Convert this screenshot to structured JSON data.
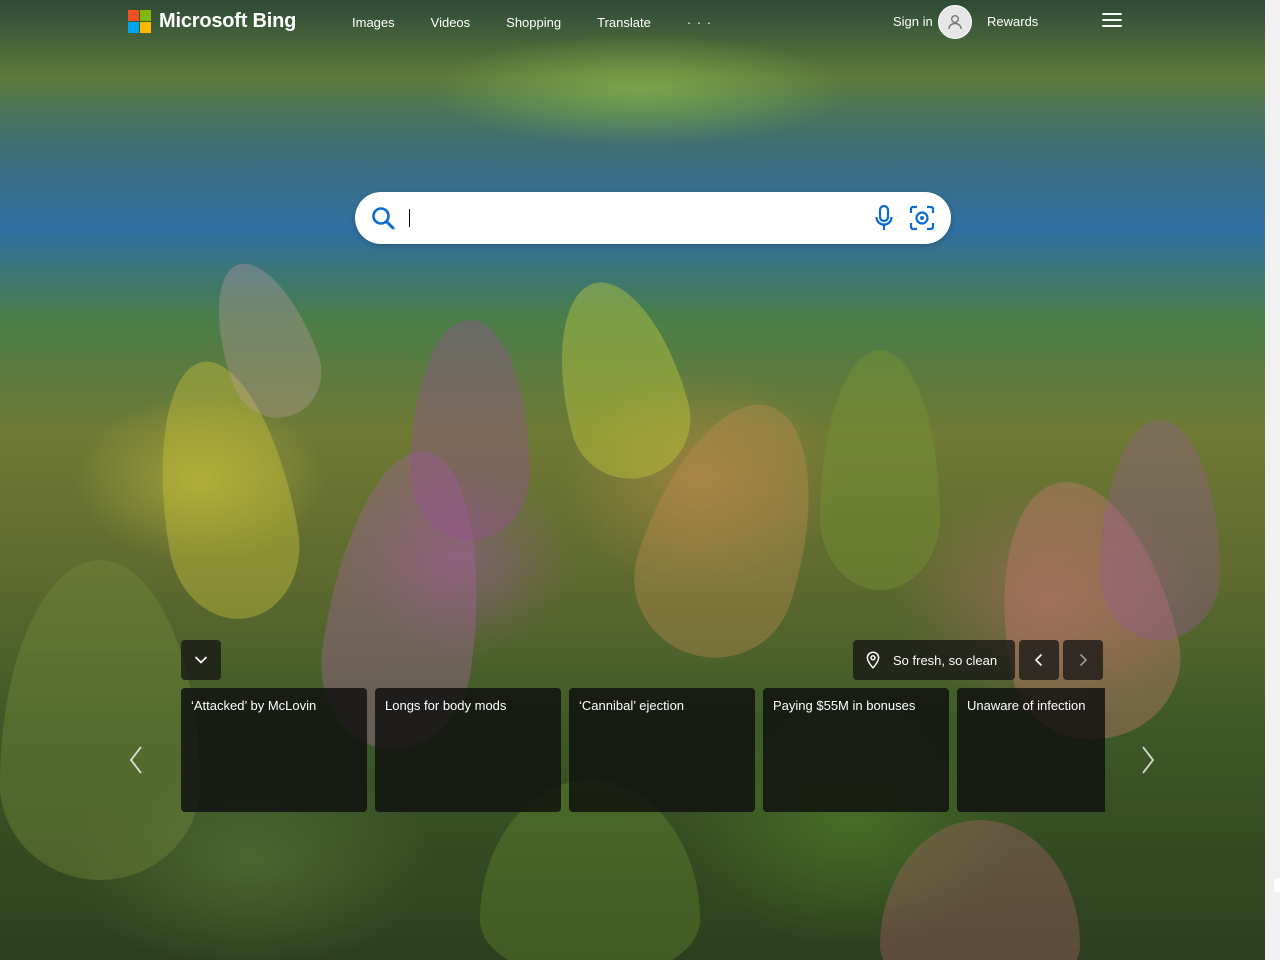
{
  "header": {
    "brand": "Microsoft Bing",
    "nav": [
      "Images",
      "Videos",
      "Shopping",
      "Translate"
    ],
    "more": "· · ·",
    "signin": "Sign in",
    "rewards": "Rewards"
  },
  "search": {
    "value": "",
    "placeholder": ""
  },
  "image_info": {
    "caption": "So fresh, so clean"
  },
  "news_cards": [
    {
      "title": "‘Attacked’ by McLovin"
    },
    {
      "title": "Longs for body mods"
    },
    {
      "title": "‘Cannibal’ ejection"
    },
    {
      "title": "Paying $55M in bonuses"
    },
    {
      "title": "Unaware of infection"
    }
  ],
  "colors": {
    "logo_red": "#f25022",
    "logo_green": "#7fba00",
    "logo_blue": "#00a4ef",
    "logo_yellow": "#ffb900",
    "search_icon": "#0a6bd6"
  },
  "icons": [
    "microsoft-logo",
    "avatar-icon",
    "hamburger-icon",
    "search-icon",
    "microphone-icon",
    "visual-search-icon",
    "chevron-down-icon",
    "location-pin-icon",
    "chevron-left-icon",
    "chevron-right-icon"
  ]
}
